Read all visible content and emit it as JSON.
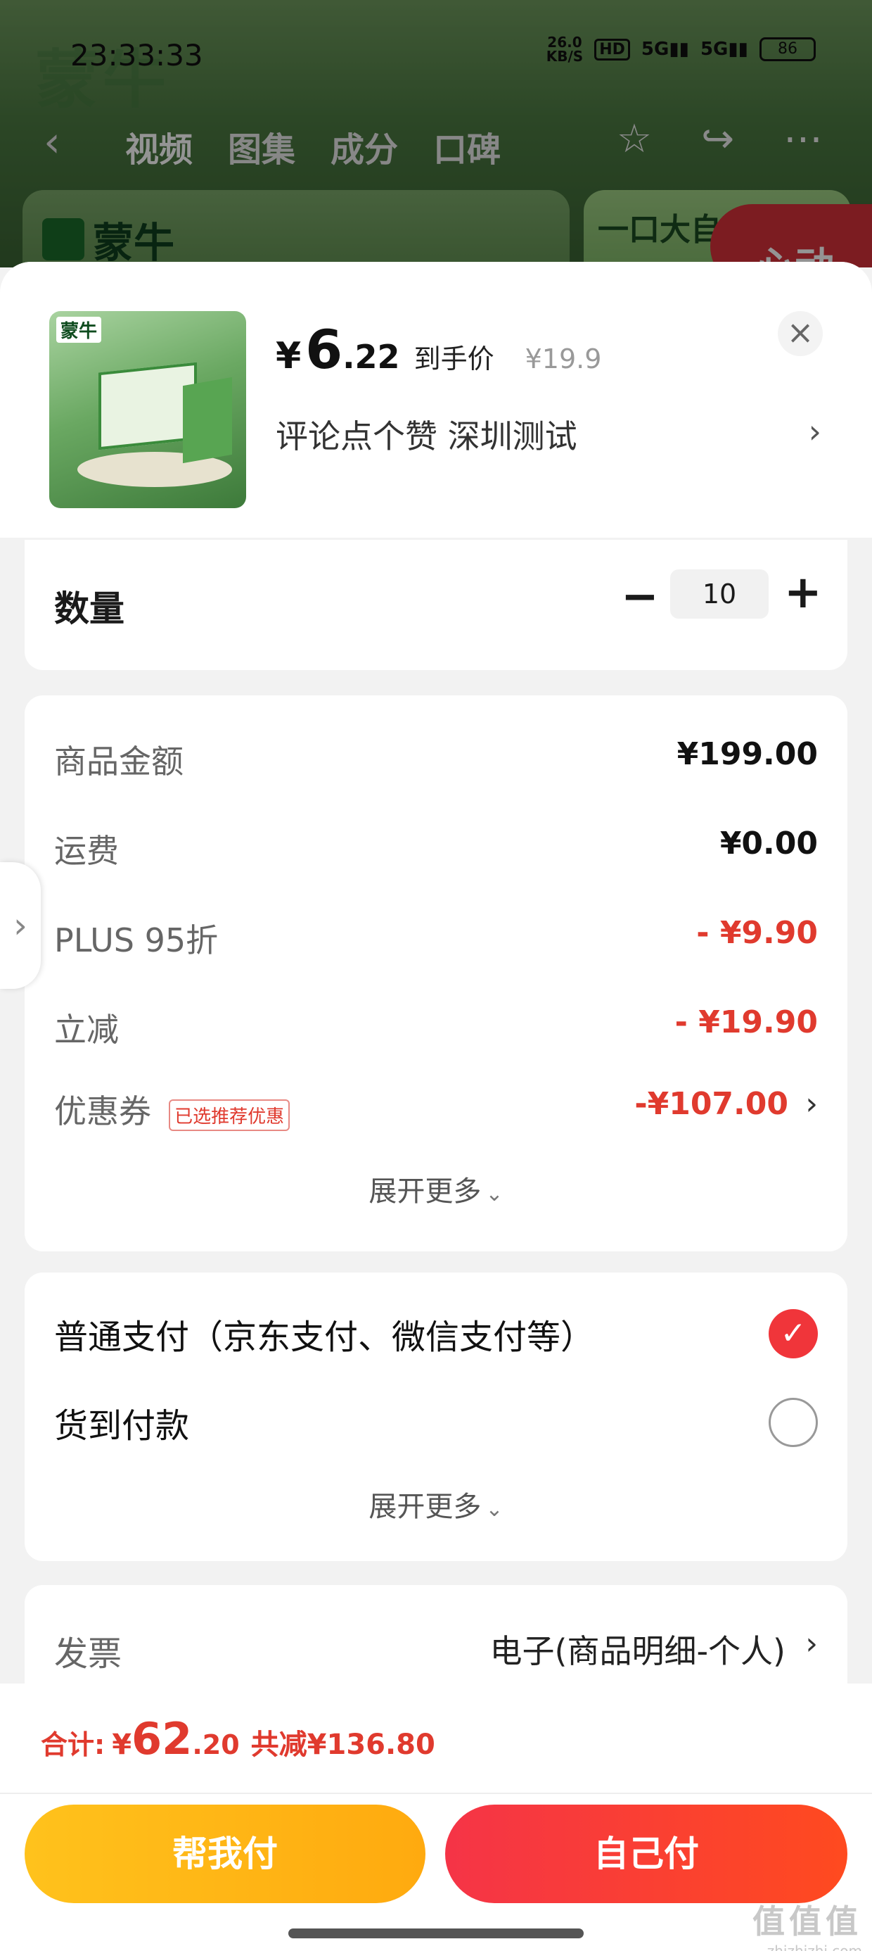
{
  "status_bar": {
    "time": "23:33:33",
    "net_speed_value": "26.0",
    "net_speed_unit": "KB/S",
    "hd_chip": "HD",
    "signal_1": "5G",
    "signal_2": "5G",
    "battery": "86"
  },
  "background": {
    "tabs": [
      "视频",
      "图集",
      "成分",
      "口碑"
    ],
    "brand": "蒙牛",
    "card_text": "一口大自然",
    "badge_text": "心动"
  },
  "product": {
    "thumb_logo": "蒙牛",
    "price_symbol": "¥",
    "price_int": "6",
    "price_dec": ".22",
    "price_tag": "到手价",
    "original_price": "¥19.9",
    "spec": "评论点个赞  深圳测试",
    "close_glyph": "×",
    "spec_arrow": "›"
  },
  "quantity": {
    "label": "数量",
    "value": "10",
    "minus": "−",
    "plus": "+"
  },
  "fees": {
    "rows": [
      {
        "label": "商品金额",
        "value": "¥199.00"
      },
      {
        "label": "运费",
        "value": "¥0.00"
      },
      {
        "label": "PLUS 95折",
        "value": "- ¥9.90"
      },
      {
        "label": "立减",
        "value": "- ¥19.90"
      },
      {
        "label": "优惠券",
        "value": "-¥107.00",
        "badge": "已选推荐优惠"
      }
    ],
    "expand_label": "展开更多"
  },
  "payment": {
    "options": [
      {
        "label": "普通支付（京东支付、微信支付等）",
        "selected": true
      },
      {
        "label": "货到付款",
        "selected": false
      }
    ],
    "expand_label": "展开更多"
  },
  "invoice": {
    "label": "发票",
    "value": "电子(商品明细-个人)"
  },
  "footer": {
    "total_label": "合计:",
    "total_symbol": "¥",
    "total_int": "62",
    "total_dec": ".20",
    "total_saving": "共减¥136.80",
    "help_pay": "帮我付",
    "self_pay": "自己付",
    "watermark_top": "值值值",
    "watermark_bottom": "zhizhizhi.com"
  },
  "colors": {
    "accent_red": "#e03a2e",
    "help_pay_yellow": "#ffb31a",
    "self_pay_red": "#f53447"
  }
}
